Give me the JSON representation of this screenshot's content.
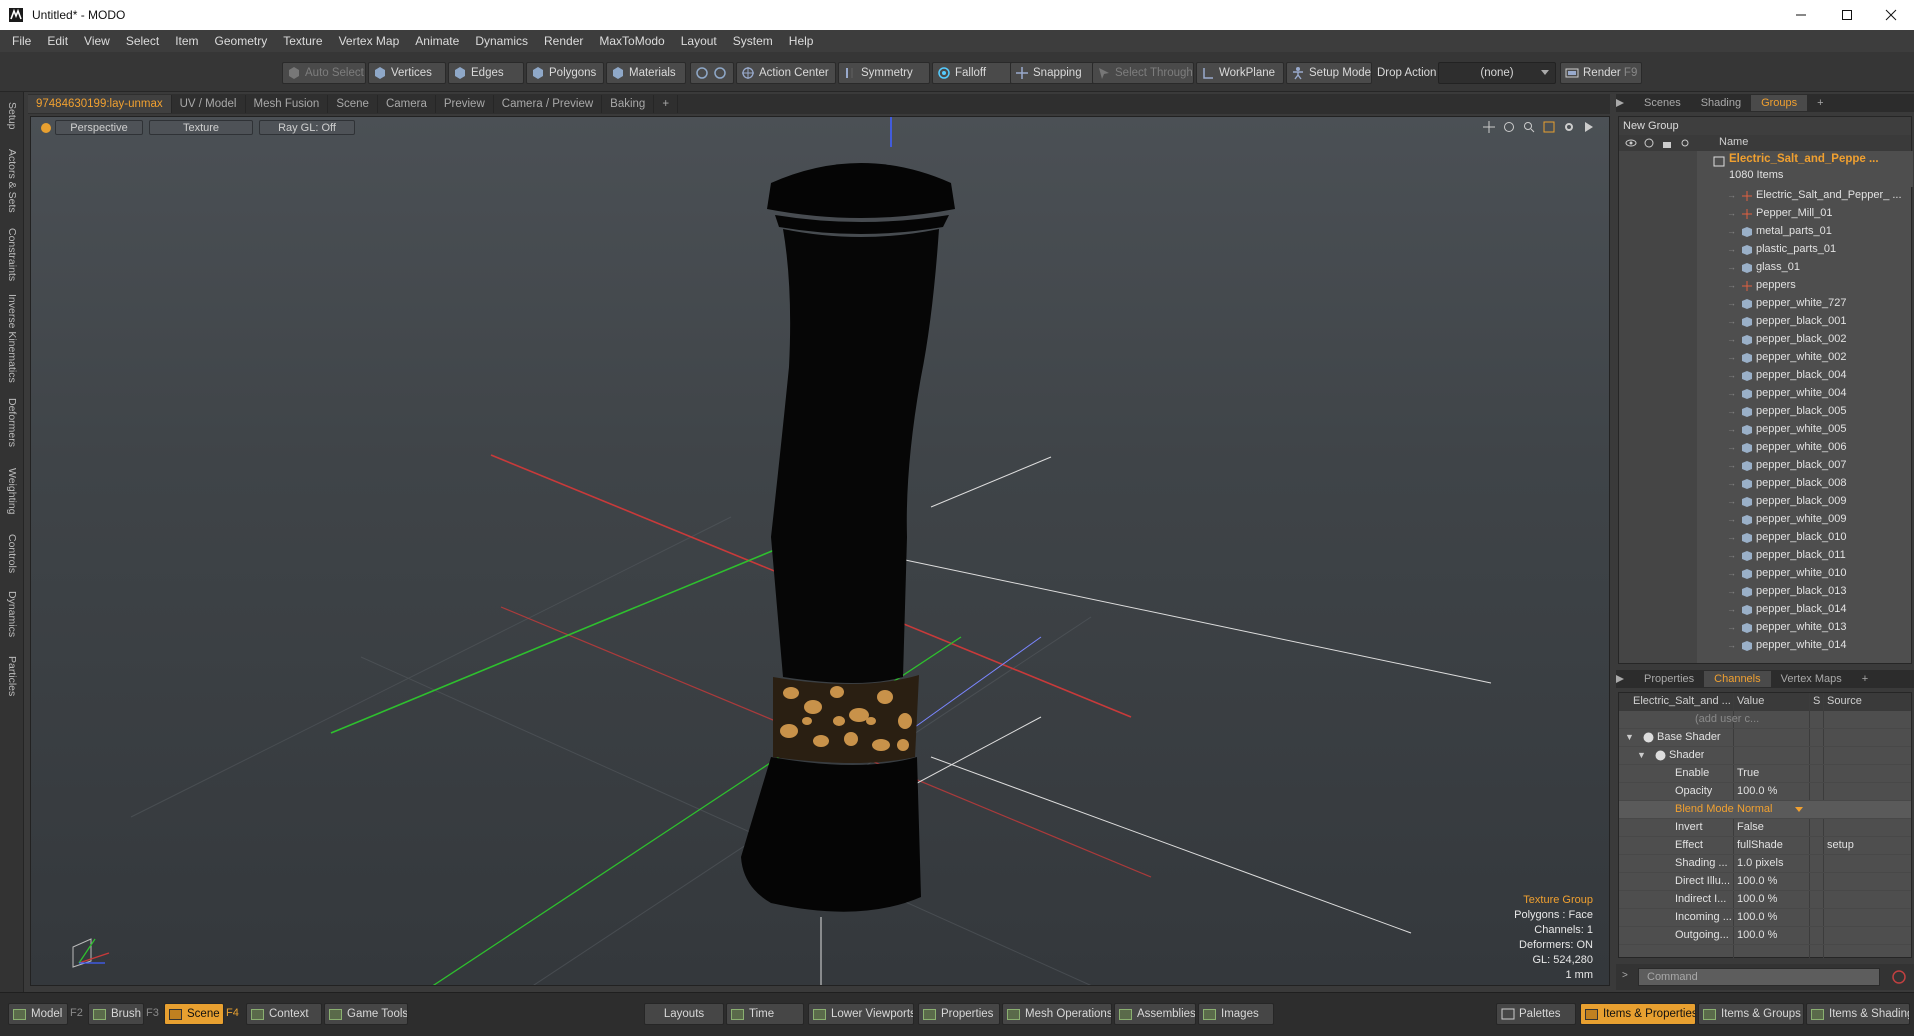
{
  "window": {
    "title": "Untitled* - MODO",
    "controls": [
      "minimize",
      "maximize",
      "close"
    ]
  },
  "menu": [
    "File",
    "Edit",
    "View",
    "Select",
    "Item",
    "Geometry",
    "Texture",
    "Vertex Map",
    "Animate",
    "Dynamics",
    "Render",
    "MaxToModo",
    "Layout",
    "System",
    "Help"
  ],
  "toolbar": {
    "auto_select": "Auto Select",
    "vertices": "Vertices",
    "edges": "Edges",
    "polygons": "Polygons",
    "materials": "Materials",
    "action_center": "Action Center",
    "symmetry": "Symmetry",
    "falloff": "Falloff",
    "snapping": "Snapping",
    "select_through": "Select Through",
    "workplane": "WorkPlane",
    "setup_mode": "Setup Mode",
    "drop_action": "Drop Action",
    "drop_value": "(none)",
    "render": "Render",
    "render_key": "F9"
  },
  "left_tabs": [
    "Setup",
    "Actors & Sets",
    "Constraints",
    "Inverse Kinematics",
    "Deformers",
    "Weighting",
    "Controls",
    "Dynamics",
    "Particles"
  ],
  "viewport_tabs": [
    "97484630199:lay-unmax",
    "UV / Model",
    "Mesh Fusion",
    "Scene",
    "Camera",
    "Preview",
    "Camera / Preview",
    "Baking",
    "+"
  ],
  "viewport": {
    "view_mode": "Perspective",
    "shading": "Texture",
    "raygl": "Ray GL: Off",
    "hud": {
      "title": "Texture Group",
      "polygons": "Polygons : Face",
      "channels": "Channels: 1",
      "deformers": "Deformers: ON",
      "gl": "GL: 524,280",
      "unit": "1 mm"
    }
  },
  "top_right_tabs": [
    "Scenes",
    "Shading",
    "Groups",
    "+"
  ],
  "groups": {
    "new_group": "New Group",
    "name_header": "Name",
    "root_name": "Electric_Salt_and_Peppe ...",
    "root_count": "1080 Items",
    "items": [
      "Electric_Salt_and_Pepper_ ...",
      "Pepper_Mill_01",
      "metal_parts_01",
      "plastic_parts_01",
      "glass_01",
      "peppers",
      "pepper_white_727",
      "pepper_black_001",
      "pepper_black_002",
      "pepper_white_002",
      "pepper_black_004",
      "pepper_white_004",
      "pepper_black_005",
      "pepper_white_005",
      "pepper_white_006",
      "pepper_black_007",
      "pepper_black_008",
      "pepper_black_009",
      "pepper_white_009",
      "pepper_black_010",
      "pepper_black_011",
      "pepper_white_010",
      "pepper_black_013",
      "pepper_black_014",
      "pepper_white_013",
      "pepper_white_014"
    ]
  },
  "bottom_right_tabs": [
    "Properties",
    "Channels",
    "Vertex Maps",
    "+"
  ],
  "channels": {
    "header_name": "Electric_Salt_and ...",
    "header_value": "Value",
    "header_s": "S",
    "header_source": "Source",
    "rows": [
      {
        "name": "(add user c...",
        "value": "",
        "source": ""
      },
      {
        "name": "Base Shader",
        "value": "",
        "source": ""
      },
      {
        "name": "Shader",
        "value": "",
        "source": ""
      },
      {
        "name": "Enable",
        "value": "True",
        "source": ""
      },
      {
        "name": "Opacity",
        "value": "100.0 %",
        "source": ""
      },
      {
        "name": "Blend Mode",
        "value": "Normal",
        "source": ""
      },
      {
        "name": "Invert",
        "value": "False",
        "source": ""
      },
      {
        "name": "Effect",
        "value": "fullShade",
        "source": "setup"
      },
      {
        "name": "Shading ...",
        "value": "1.0 pixels",
        "source": ""
      },
      {
        "name": "Direct Illu...",
        "value": "100.0 %",
        "source": ""
      },
      {
        "name": "Indirect I...",
        "value": "100.0 %",
        "source": ""
      },
      {
        "name": "Incoming ...",
        "value": "100.0 %",
        "source": ""
      },
      {
        "name": "Outgoing...",
        "value": "100.0 %",
        "source": ""
      }
    ]
  },
  "command": {
    "placeholder": "Command"
  },
  "bottombar": {
    "model": "Model",
    "model_key": "F2",
    "brush": "Brush",
    "brush_key": "F3",
    "scene": "Scene",
    "scene_key": "F4",
    "context": "Context",
    "game_tools": "Game Tools",
    "layouts": "Layouts",
    "time": "Time",
    "lower_viewports": "Lower Viewports",
    "properties": "Properties",
    "mesh_operations": "Mesh Operations",
    "assemblies": "Assemblies",
    "images": "Images",
    "palettes": "Palettes",
    "items_properties": "Items & Properties",
    "items_groups": "Items & Groups",
    "items_shading": "Items & Shading"
  },
  "colors": {
    "accent": "#f0a030",
    "axis_x": "#d03030",
    "axis_y": "#30c030",
    "axis_z": "#4060ff"
  }
}
